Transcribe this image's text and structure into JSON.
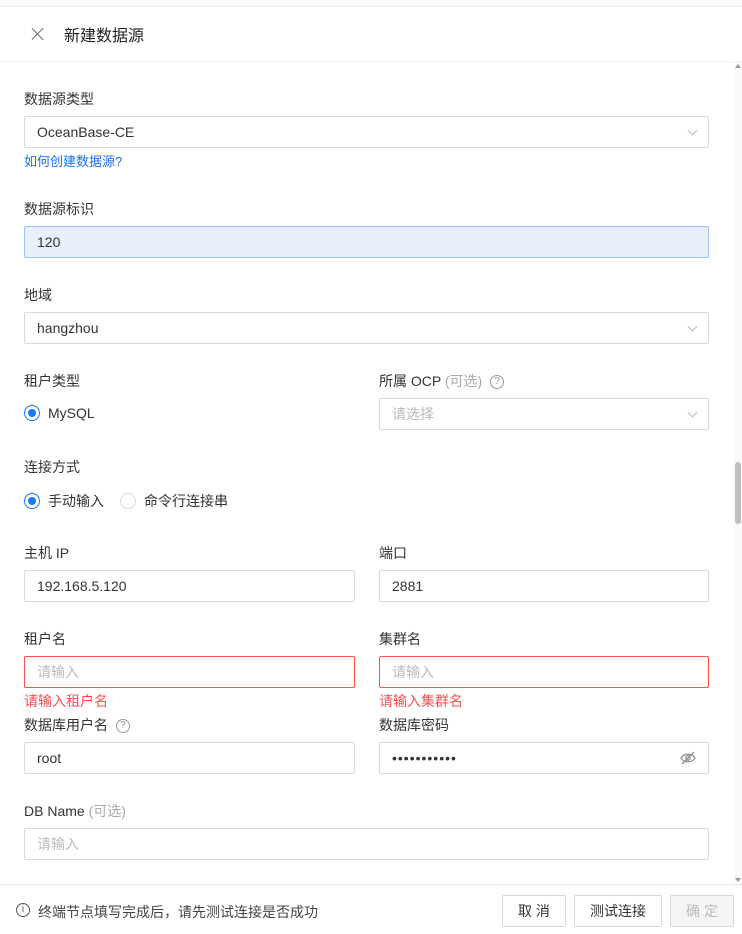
{
  "header": {
    "title": "新建数据源"
  },
  "form": {
    "ds_type": {
      "label": "数据源类型",
      "value": "OceanBase-CE",
      "help_link": "如何创建数据源?"
    },
    "ds_id": {
      "label": "数据源标识",
      "value": "120"
    },
    "region": {
      "label": "地域",
      "value": "hangzhou"
    },
    "tenant_type": {
      "label": "租户类型",
      "options": [
        "MySQL"
      ],
      "selected": "MySQL"
    },
    "ocp": {
      "label": "所属 OCP",
      "optional": "(可选)",
      "placeholder": "请选择"
    },
    "connect_mode": {
      "label": "连接方式",
      "options": [
        "手动输入",
        "命令行连接串"
      ],
      "selected": "手动输入"
    },
    "host": {
      "label": "主机 IP",
      "value": "192.168.5.120"
    },
    "port": {
      "label": "端口",
      "value": "2881"
    },
    "tenant_name": {
      "label": "租户名",
      "placeholder": "请输入",
      "error": "请输入租户名"
    },
    "cluster_name": {
      "label": "集群名",
      "placeholder": "请输入",
      "error": "请输入集群名"
    },
    "db_user": {
      "label": "数据库用户名",
      "value": "root"
    },
    "db_password": {
      "label": "数据库密码",
      "value": "•••••••••••"
    },
    "db_name": {
      "label": "DB Name",
      "optional": "(可选)",
      "placeholder": "请输入"
    }
  },
  "footer": {
    "tip": "终端节点填写完成后，请先测试连接是否成功",
    "cancel_label": "取 消",
    "test_label": "测试连接",
    "ok_label": "确 定"
  },
  "colors": {
    "primary": "#1677ff",
    "error": "#ff4d4f",
    "link": "#1a73e8"
  }
}
